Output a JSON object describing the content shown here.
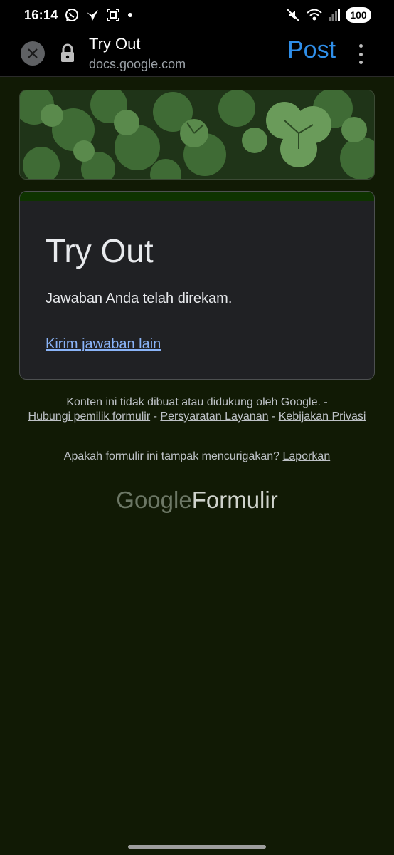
{
  "status_bar": {
    "time": "16:14",
    "left_icons": [
      "whatsapp-icon",
      "bird-icon",
      "screenshot-icon",
      "dot-icon"
    ],
    "right_icons": [
      "mute-icon",
      "wifi-icon",
      "signal-icon"
    ],
    "battery": "100"
  },
  "toolbar": {
    "title": "Try Out",
    "url": "docs.google.com",
    "post_label": "Post"
  },
  "form": {
    "title": "Try Out",
    "confirmation": "Jawaban Anda telah direkam.",
    "another_response_link": "Kirim jawaban lain"
  },
  "footer": {
    "disclaimer": "Konten ini tidak dibuat atau didukung oleh Google. -",
    "contact_owner": "Hubungi pemilik formulir",
    "sep1": " - ",
    "terms": "Persyaratan Layanan",
    "sep2": " - ",
    "privacy": "Kebijakan Privasi",
    "suspicious_question": "Apakah formulir ini tampak mencurigakan?",
    "report_link": "Laporkan",
    "brand_google": "Google",
    "brand_forms": "Formulir"
  },
  "colors": {
    "page_background": "#111a05",
    "accent_blue": "#2f8ee8",
    "link_blue": "#8ab4f8",
    "card_top_bar": "#0e3300"
  }
}
